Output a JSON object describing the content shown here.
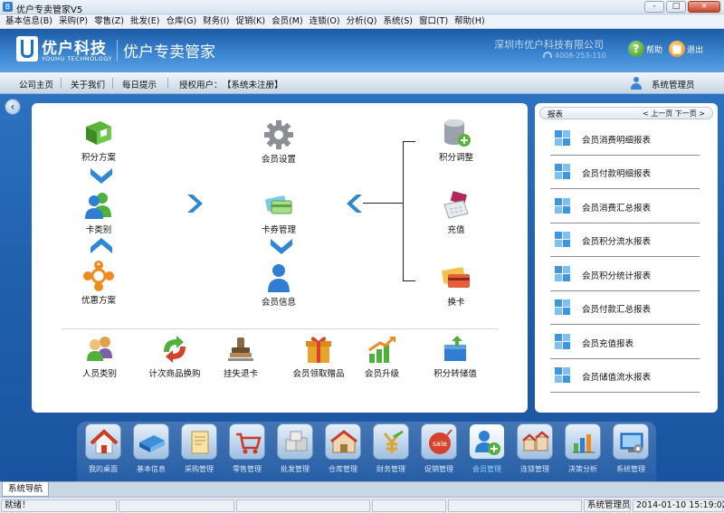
{
  "window": {
    "title": "优户专卖管家V5",
    "icon": "B",
    "minimize": "-",
    "maximize": "□",
    "close": "×"
  },
  "menu": [
    "基本信息(B)",
    "采购(P)",
    "零售(Z)",
    "批发(E)",
    "仓库(G)",
    "财务(I)",
    "促销(K)",
    "会员(M)",
    "连锁(O)",
    "分析(Q)",
    "系统(S)",
    "窗口(T)",
    "帮助(H)"
  ],
  "header": {
    "logo_cn": "优户科技",
    "logo_en": "YOUHU TECHNOLOGY",
    "product": "优户专卖管家",
    "company": "深圳市优户科技有限公司",
    "phone": "4008-253-110",
    "help": "帮助",
    "exit": "退出"
  },
  "nav": {
    "links": [
      "公司主页",
      "关于我们",
      "每日提示"
    ],
    "license_label": "授权用户：",
    "license_value": "【系统未注册】",
    "user": "系统管理员"
  },
  "flow": {
    "points_plan": "积分方案",
    "card_type": "卡类别",
    "discount_plan": "优惠方案",
    "member_settings": "会员设置",
    "card_management": "卡券管理",
    "member_info": "会员信息",
    "points_adjust": "积分调整",
    "recharge": "充值",
    "change_card": "换卡"
  },
  "actions": [
    "人员类别",
    "计次商品换购",
    "挂失退卡",
    "会员领取赠品",
    "会员升级",
    "积分转储值"
  ],
  "reports": {
    "title": "报表",
    "pager": "< 上一页  下一页 >",
    "items": [
      "会员消费明细报表",
      "会员付款明细报表",
      "会员消费汇总报表",
      "会员积分流水报表",
      "会员积分统计报表",
      "会员付款汇总报表",
      "会员充值报表",
      "会员储值流水报表"
    ]
  },
  "dock": {
    "items": [
      "我的桌面",
      "基本信息",
      "采购管理",
      "零售管理",
      "批发管理",
      "仓库管理",
      "财务管理",
      "促销管理",
      "会员管理",
      "连锁管理",
      "决策分析",
      "系统管理"
    ],
    "active": "会员管理",
    "sale_badge": "sale"
  },
  "tabs": [
    "系统导航"
  ],
  "status": {
    "ready": "就绪！",
    "user": "系统管理员",
    "datetime": "2014-01-10 15:19:02"
  },
  "colors": {
    "header_blue": "#2f74c4",
    "main_blue": "#1f5fac",
    "active_label": "#8ad7ff"
  }
}
